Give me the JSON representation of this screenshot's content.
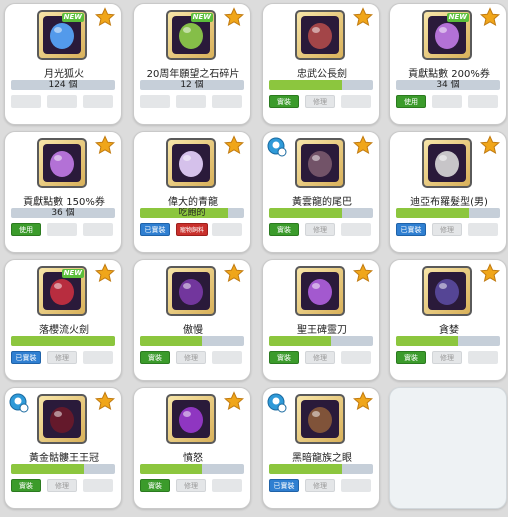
{
  "cards": [
    {
      "name": "月光狐火",
      "bar_text": "124 個",
      "fill": 0,
      "new": true,
      "badge": false,
      "color": "#58a8ff",
      "buttons": [
        null,
        null,
        null
      ]
    },
    {
      "name": "20周年願望之石碎片",
      "bar_text": "12 個",
      "fill": 0,
      "new": true,
      "badge": false,
      "color": "#8fd04a",
      "buttons": [
        null,
        null,
        null
      ]
    },
    {
      "name": "忠武公長劍",
      "bar_text": "",
      "fill": 0.7,
      "new": false,
      "badge": false,
      "color": "#b04a4a",
      "buttons": [
        {
          "label": "實裝",
          "style": "green"
        },
        {
          "label": "修理",
          "style": "gray"
        },
        null
      ]
    },
    {
      "name": "貢獻點數 200%券",
      "bar_text": "34 個",
      "fill": 0,
      "new": true,
      "badge": false,
      "color": "#c27be8",
      "buttons": [
        {
          "label": "使用",
          "style": "green"
        },
        null,
        null
      ]
    },
    {
      "name": "貢獻點數 150%券",
      "bar_text": "36 個",
      "fill": 0,
      "new": false,
      "badge": false,
      "color": "#c27be8",
      "buttons": [
        {
          "label": "使用",
          "style": "green"
        },
        null,
        null
      ]
    },
    {
      "name": "偉大的青龍",
      "bar_text": "吃飽的",
      "fill": 0.85,
      "new": false,
      "badge": false,
      "color": "#e8d4ff",
      "buttons": [
        {
          "label": "已實裝",
          "style": "blue"
        },
        {
          "label": "寵物飼料",
          "style": "red"
        },
        null
      ]
    },
    {
      "name": "黃雲龍的尾巴",
      "bar_text": "",
      "fill": 0.7,
      "new": false,
      "badge": true,
      "color": "#7a5a6e",
      "buttons": [
        {
          "label": "實裝",
          "style": "green"
        },
        {
          "label": "修理",
          "style": "gray"
        },
        null
      ]
    },
    {
      "name": "迪亞布羅髮型(男)",
      "bar_text": "",
      "fill": 0.7,
      "new": false,
      "badge": false,
      "color": "#d8d8d8",
      "buttons": [
        {
          "label": "已實裝",
          "style": "blue"
        },
        {
          "label": "修理",
          "style": "gray"
        },
        null
      ]
    },
    {
      "name": "落櫻流火劍",
      "bar_text": "",
      "fill": 1.0,
      "new": true,
      "badge": false,
      "color": "#c83040",
      "buttons": [
        {
          "label": "已實裝",
          "style": "blue"
        },
        {
          "label": "修理",
          "style": "gray"
        },
        null
      ]
    },
    {
      "name": "傲慢",
      "bar_text": "",
      "fill": 0.6,
      "new": false,
      "badge": false,
      "color": "#7a3aa8",
      "buttons": [
        {
          "label": "實裝",
          "style": "green"
        },
        {
          "label": "修理",
          "style": "gray"
        },
        null
      ]
    },
    {
      "name": "聖王碑靈刀",
      "bar_text": "",
      "fill": 0.6,
      "new": false,
      "badge": false,
      "color": "#b060e0",
      "buttons": [
        {
          "label": "實裝",
          "style": "green"
        },
        {
          "label": "修理",
          "style": "gray"
        },
        null
      ]
    },
    {
      "name": "貪婪",
      "bar_text": "",
      "fill": 0.6,
      "new": false,
      "badge": false,
      "color": "#5a4aa0",
      "buttons": [
        {
          "label": "實裝",
          "style": "green"
        },
        {
          "label": "修理",
          "style": "gray"
        },
        null
      ]
    },
    {
      "name": "黃金骷髏王王冠",
      "bar_text": "",
      "fill": 0.7,
      "new": false,
      "badge": true,
      "color": "#6a1a2a",
      "buttons": [
        {
          "label": "實裝",
          "style": "green"
        },
        {
          "label": "修理",
          "style": "gray"
        },
        null
      ]
    },
    {
      "name": "憤怒",
      "bar_text": "",
      "fill": 0.6,
      "new": false,
      "badge": false,
      "color": "#9a3ad0",
      "buttons": [
        {
          "label": "實裝",
          "style": "green"
        },
        {
          "label": "修理",
          "style": "gray"
        },
        null
      ]
    },
    {
      "name": "黑暗龍族之眼",
      "bar_text": "",
      "fill": 0.7,
      "new": false,
      "badge": true,
      "color": "#8a5a3a",
      "buttons": [
        {
          "label": "已實裝",
          "style": "blue"
        },
        {
          "label": "修理",
          "style": "gray"
        },
        null
      ]
    },
    {
      "empty": true
    }
  ],
  "new_label": "NEW",
  "colors": {
    "progress_fill": "#8cc63e",
    "progress_track": "#c6cfd9",
    "equip_green": "#3b9b2b",
    "equipped_blue": "#2f7fd1",
    "pet_food_red": "#c9302c",
    "star_gold": "#f0a61a"
  },
  "icons": {
    "favorite": "star-icon",
    "account_badge": "account-share-icon"
  }
}
